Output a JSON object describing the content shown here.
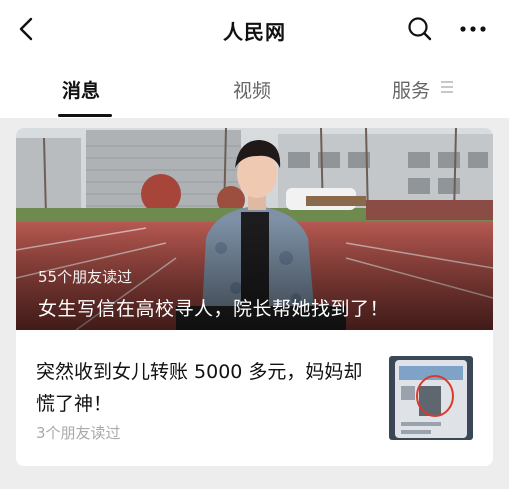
{
  "header": {
    "title": "人民网",
    "back_icon": "chevron-left-icon",
    "search_icon": "search-icon",
    "more_icon": "more-dots-icon"
  },
  "tabs": [
    {
      "label": "消息",
      "active": true
    },
    {
      "label": "视频",
      "active": false
    },
    {
      "label": "服务",
      "active": false
    }
  ],
  "feed": {
    "hero": {
      "read_count": "55个朋友读过",
      "title": "女生写信在高校寻人，院长帮她找到了！"
    },
    "item": {
      "title": "突然收到女儿转账 5000 多元，妈妈却慌了神！",
      "read_count": "3个朋友读过"
    }
  },
  "colors": {
    "background": "#ededed",
    "surface": "#ffffff",
    "text_primary": "#111111",
    "text_secondary": "#aaaaaa"
  }
}
